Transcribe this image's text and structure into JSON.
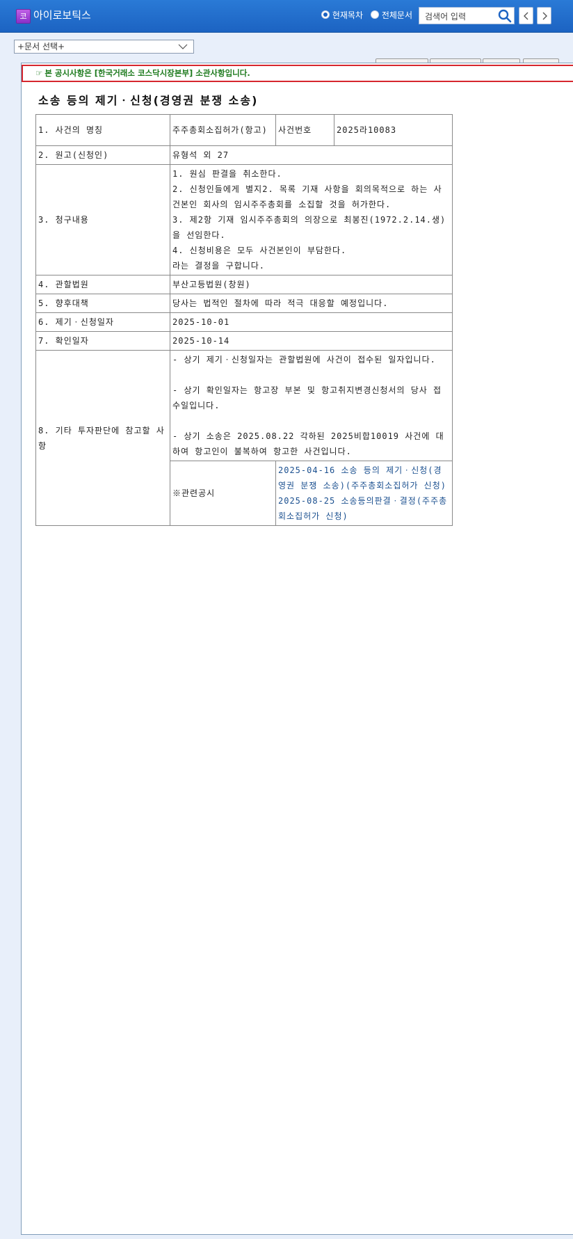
{
  "header": {
    "logo_glyph": "코",
    "company": "아이로보틱스",
    "radio_current": "현재목차",
    "radio_all": "전체문서",
    "search_placeholder": "검색어 입력"
  },
  "doc_selector": {
    "value": "+문서 선택+"
  },
  "notice": {
    "text": "본 공시사항은 [한국거래소 코스닥시장본부] 소관사항입니다."
  },
  "title": "소송 등의 제기ㆍ신청(경영권 분쟁 소송)",
  "table": {
    "r1_label": "1. 사건의 명칭",
    "r1_value": "주주총회소집허가(항고)",
    "r1_case_label": "사건번호",
    "r1_case_value": "2025라10083",
    "r2_label": "2. 원고(신청인)",
    "r2_value": "유형석 외 27",
    "r3_label": "3. 청구내용",
    "r3_lines": [
      "1. 원심 판결을 취소한다.",
      "2. 신청인들에게 별지2. 목록 기재 사항을 회의목적으로 하는 사건본인 회사의 임시주주총회를 소집할 것을 허가한다.",
      "3. 제2항 기재 임시주주총회의 의장으로 최봉진(1972.2.14.생)을 선임한다.",
      "4. 신청비용은 모두 사건본인이 부담한다.",
      "라는 결정을 구합니다."
    ],
    "r4_label": "4. 관할법원",
    "r4_value": "부산고등법원(창원)",
    "r5_label": "5. 향후대책",
    "r5_value": "당사는 법적인 절차에 따라 적극 대응할 예정입니다.",
    "r6_label": "6. 제기ㆍ신청일자",
    "r6_value": "2025-10-01",
    "r7_label": "7. 확인일자",
    "r7_value": "2025-10-14",
    "r8_label": "8. 기타 투자판단에 참고할 사항",
    "r8_note1": "- 상기 제기ㆍ신청일자는 관할법원에 사건이 접수된 일자입니다.",
    "r8_note2": "- 상기 확인일자는 항고장 부본 및 항고취지변경신청서의 당사 접수일입니다.",
    "r8_note3": "- 상기 소송은 2025.08.22 각하된 2025비합10019 사건에 대하여 항고인이 불복하여 항고한 사건입니다.",
    "related_label": "※관련공시",
    "related_links": [
      "2025-04-16 소송 등의 제기ㆍ신청(경영권 분쟁 소송)(주주총회소집허가 신청)",
      "2025-08-25 소송등의판결ㆍ결정(주주총회소집허가 신청)"
    ]
  },
  "colors": {
    "header_bg": "#1c63c2",
    "notice_border": "#d6262e",
    "notice_text": "#1d7a1d",
    "link": "#1a4f8f"
  }
}
